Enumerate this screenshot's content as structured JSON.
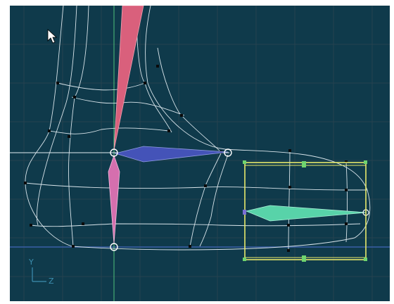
{
  "viewport": {
    "name": "perspective-viewport",
    "background": "#0f3a4b",
    "grid_color": "#25424f",
    "wire_color": "#d8e4ea"
  },
  "axis_gizmo": {
    "y_label": "Y",
    "z_label": "Z",
    "color": "#3d8fb0"
  },
  "bones": {
    "leg": "#d9607c",
    "hip": "#d56fae",
    "foot": "#4453b8",
    "toe": "#58d3a9"
  },
  "selection": {
    "color": "#e8e86a",
    "handle_color": "#6fd46f"
  },
  "cursor": {
    "icon": "arrow-cursor-icon"
  }
}
